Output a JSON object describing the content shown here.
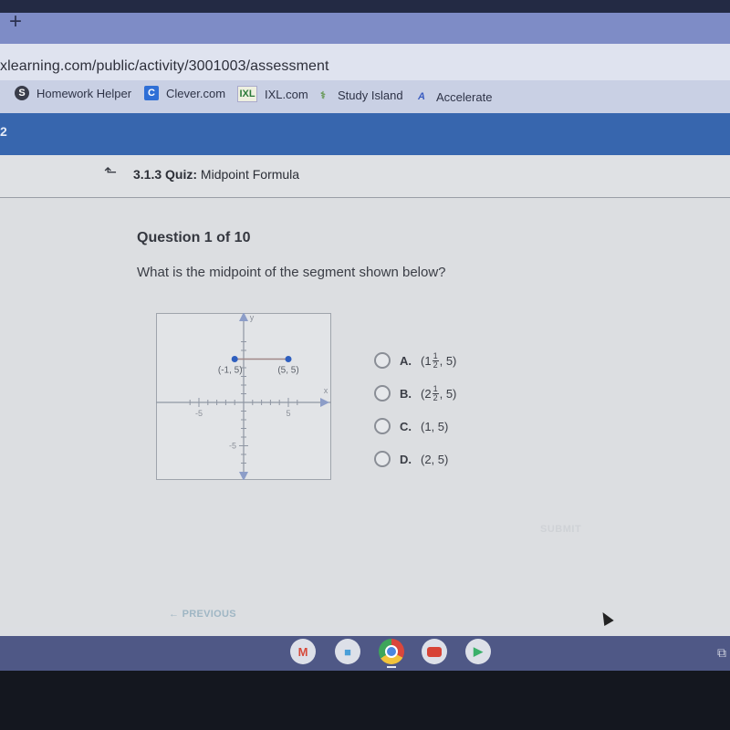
{
  "browser": {
    "new_tab_icon": "plus-icon",
    "url": "xlearning.com/public/activity/3001003/assessment",
    "bookmarks": [
      {
        "label": "Homework Helper",
        "icon": "homework-helper-icon",
        "glyph": "S"
      },
      {
        "label": "Clever.com",
        "icon": "clever-icon",
        "glyph": "C"
      },
      {
        "label": "IXL.com",
        "icon": "ixl-icon",
        "glyph": "IXL"
      },
      {
        "label": "Study Island",
        "icon": "study-island-icon",
        "glyph": "⚕"
      },
      {
        "label": "Accelerate",
        "icon": "accelerate-icon",
        "glyph": "A"
      }
    ]
  },
  "header": {
    "logo_fragment": "2",
    "up_icon": "⬑",
    "quiz_number": "3.1.3",
    "quiz_label": "Quiz:",
    "quiz_title": "Midpoint Formula"
  },
  "question": {
    "counter": "Question 1 of 10",
    "prompt": "What is the midpoint of the segment shown below?"
  },
  "graph": {
    "x_label": "x",
    "y_label": "y",
    "x_range": [
      -6,
      6
    ],
    "y_range": [
      -7,
      7
    ],
    "tick_labels": {
      "x_neg": "-5",
      "x_pos": "5",
      "y_neg": "-5"
    },
    "points": [
      {
        "x": -1,
        "y": 5,
        "label": "(-1, 5)"
      },
      {
        "x": 5,
        "y": 5,
        "label": "(5, 5)"
      }
    ],
    "point_color": "#2f5fbf",
    "segment_color": "#a08888"
  },
  "choices": [
    {
      "letter": "A.",
      "whole": "1",
      "num": "1",
      "den": "2",
      "rest": ", 5)",
      "open": "("
    },
    {
      "letter": "B.",
      "whole": "2",
      "num": "1",
      "den": "2",
      "rest": ", 5)",
      "open": "("
    },
    {
      "letter": "C.",
      "text": "(1, 5)"
    },
    {
      "letter": "D.",
      "text": "(2, 5)"
    }
  ],
  "footer": {
    "submit_label": "SUBMIT",
    "previous_label": "← PREVIOUS"
  },
  "shelf": {
    "apps": [
      "gmail",
      "docs",
      "chrome",
      "youtube",
      "play-store"
    ],
    "gmail_glyph": "M",
    "docs_glyph": "■",
    "play_glyph": "▶",
    "tray_glyph": "⧉"
  }
}
